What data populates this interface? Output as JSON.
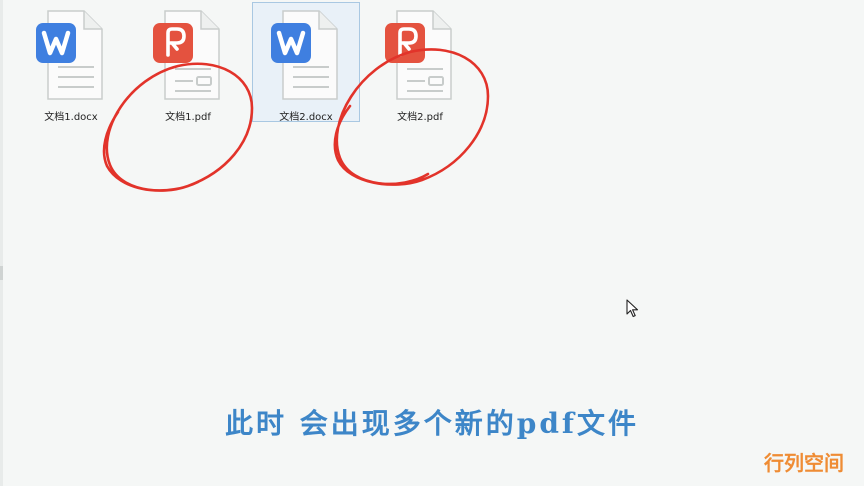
{
  "files": [
    {
      "name": "文档1.docx",
      "type": "word",
      "selected": false
    },
    {
      "name": "文档1.pdf",
      "type": "pdf",
      "selected": false
    },
    {
      "name": "文档2.docx",
      "type": "word",
      "selected": true
    },
    {
      "name": "文档2.pdf",
      "type": "pdf",
      "selected": false
    }
  ],
  "subtitle": "此时  会出现多个新的pdf文件",
  "watermark": "行列空间",
  "colors": {
    "word_badge": "#3f7fe0",
    "pdf_badge": "#e4523f",
    "annotation": "#e2332a",
    "subtitle": "#3d86c8",
    "watermark": "#ef8c34",
    "selection": "#e9f1f8"
  }
}
